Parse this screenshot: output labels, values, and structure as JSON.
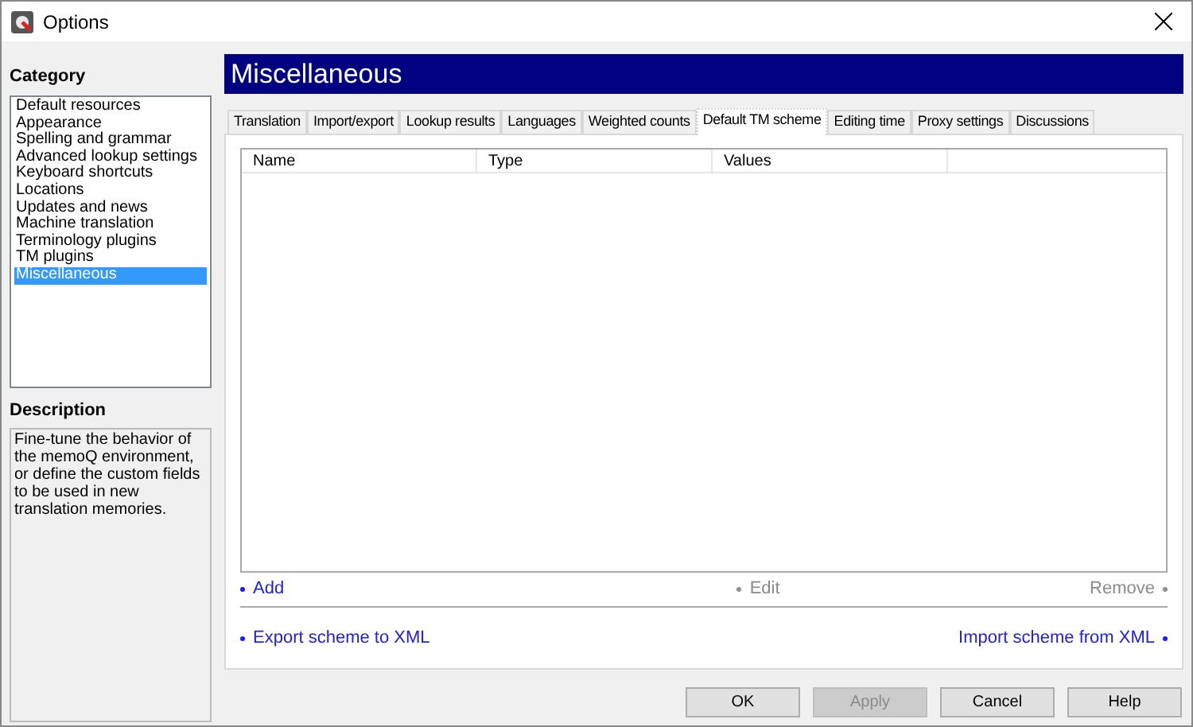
{
  "window": {
    "title": "Options"
  },
  "category": {
    "heading": "Category",
    "items": [
      {
        "label": "Default resources",
        "selected": false
      },
      {
        "label": "Appearance",
        "selected": false
      },
      {
        "label": "Spelling and grammar",
        "selected": false
      },
      {
        "label": "Advanced lookup settings",
        "selected": false
      },
      {
        "label": "Keyboard shortcuts",
        "selected": false
      },
      {
        "label": "Locations",
        "selected": false
      },
      {
        "label": "Updates and news",
        "selected": false
      },
      {
        "label": "Machine translation",
        "selected": false
      },
      {
        "label": "Terminology plugins",
        "selected": false
      },
      {
        "label": "TM plugins",
        "selected": false
      },
      {
        "label": "Miscellaneous",
        "selected": true
      }
    ]
  },
  "description": {
    "heading": "Description",
    "text": "Fine-tune the behavior of the memoQ environment, or define the custom fields to be used in new translation memories."
  },
  "page_title": "Miscellaneous",
  "tabs": [
    {
      "label": "Translation",
      "selected": false
    },
    {
      "label": "Import/export",
      "selected": false
    },
    {
      "label": "Lookup results",
      "selected": false
    },
    {
      "label": "Languages",
      "selected": false
    },
    {
      "label": "Weighted counts",
      "selected": false
    },
    {
      "label": "Default TM scheme",
      "selected": true
    },
    {
      "label": "Editing time",
      "selected": false
    },
    {
      "label": "Proxy settings",
      "selected": false
    },
    {
      "label": "Discussions",
      "selected": false
    }
  ],
  "table": {
    "columns": [
      "Name",
      "Type",
      "Values"
    ]
  },
  "row_actions": [
    {
      "label": "Add",
      "disabled": false
    },
    {
      "label": "Edit",
      "disabled": true
    },
    {
      "label": "Remove",
      "disabled": true
    }
  ],
  "scheme_actions": [
    {
      "label": "Export scheme to XML",
      "disabled": false
    },
    {
      "label": "Import scheme from XML",
      "disabled": false
    }
  ],
  "buttons": [
    {
      "label": "OK",
      "disabled": false
    },
    {
      "label": "Apply",
      "disabled": true
    },
    {
      "label": "Cancel",
      "disabled": false
    },
    {
      "label": "Help",
      "disabled": false
    }
  ]
}
